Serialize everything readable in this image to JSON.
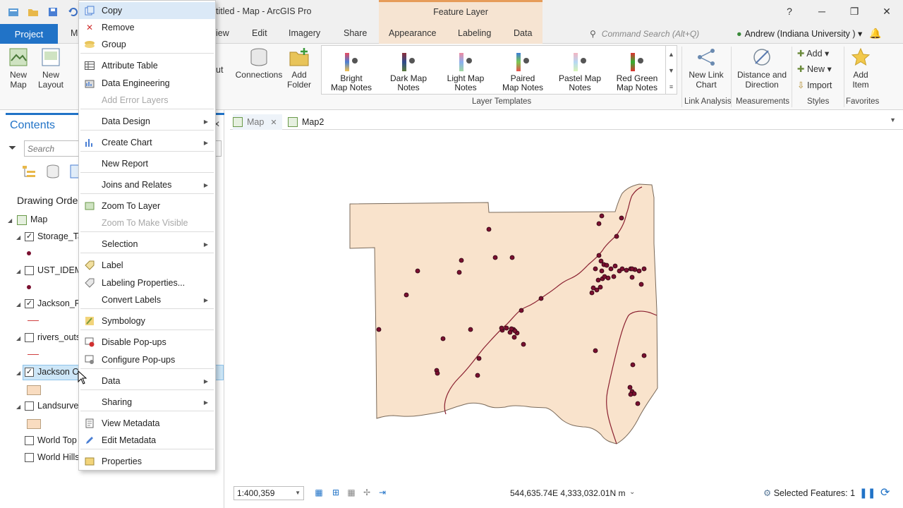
{
  "window": {
    "title": "titled - Map - ArcGIS Pro",
    "contextual_band": "Feature Layer",
    "help": "?",
    "minimize": "─",
    "restore": "❐",
    "close": "✕"
  },
  "tabs": {
    "project": "Project",
    "map_partial": "M",
    "view_partial": "iew",
    "edit": "Edit",
    "imagery": "Imagery",
    "share": "Share",
    "appearance": "Appearance",
    "labeling": "Labeling",
    "data": "Data"
  },
  "command_search": {
    "placeholder": "Command Search (Alt+Q)"
  },
  "user": {
    "name": "Andrew (Indiana University )"
  },
  "ribbon": {
    "new_map": "New\nMap",
    "new_layout": "New\nLayout",
    "out_partial": "ut",
    "connections": "Connections",
    "add_folder": "Add\nFolder",
    "gallery": [
      {
        "label": "Bright\nMap Notes",
        "colors": [
          "#e84a5f",
          "#4a7fd4",
          "#f2c14e"
        ]
      },
      {
        "label": "Dark Map\nNotes",
        "colors": [
          "#8b2f3a",
          "#2f4b8b",
          "#5a7a3a"
        ]
      },
      {
        "label": "Light Map\nNotes",
        "colors": [
          "#f08aa0",
          "#8ab0f0",
          "#a0d8a0"
        ]
      },
      {
        "label": "Paired\nMap Notes",
        "colors": [
          "#3b7dd8",
          "#7ec850",
          "#e85050"
        ]
      },
      {
        "label": "Pastel Map\nNotes",
        "colors": [
          "#f4b6c2",
          "#b6d8f4",
          "#d8f4b6"
        ]
      },
      {
        "label": "Red Green\nMap Notes",
        "colors": [
          "#e03030",
          "#30b030",
          "#e03030"
        ]
      }
    ],
    "layer_templates": "Layer Templates",
    "new_link_chart": "New Link\nChart",
    "link_analysis": "Link Analysis",
    "distance_direction": "Distance and\nDirection",
    "measurements": "Measurements",
    "styles_add": "Add",
    "styles_new": "New",
    "styles_import": "Import",
    "styles": "Styles",
    "add_item": "Add\nItem",
    "favorites": "Favorites"
  },
  "contents": {
    "title": "Contents",
    "search_placeholder": "Search",
    "drawing_order": "Drawing Orde",
    "map_label": "Map",
    "layers": [
      {
        "name": "Storage_Ta",
        "checked": true,
        "symbol": "point"
      },
      {
        "name": "UST_IDEM_",
        "checked": false,
        "symbol": "point"
      },
      {
        "name": "Jackson_Ri",
        "checked": true,
        "symbol": "line"
      },
      {
        "name": "rivers_outs",
        "checked": false,
        "symbol": "line"
      },
      {
        "name": "Jackson Co",
        "checked": true,
        "symbol": "polygon"
      },
      {
        "name": "Landsurvey",
        "checked": false,
        "symbol": "polygon"
      },
      {
        "name": "World Top",
        "checked": false,
        "symbol": "none"
      },
      {
        "name": "World Hills",
        "checked": false,
        "symbol": "none"
      }
    ]
  },
  "map_tabs": {
    "map": "Map",
    "map2": "Map2"
  },
  "status": {
    "scale": "1:400,359",
    "coordinates": "544,635.74E 4,333,032.01N m",
    "selected_features": "Selected Features: 1"
  },
  "context_menu": {
    "items": [
      {
        "label": "Copy",
        "icon": "copy-icon",
        "highlight": true
      },
      {
        "label": "Remove",
        "icon": "remove-icon"
      },
      {
        "label": "Group",
        "icon": "group-icon"
      },
      {
        "label": "Attribute Table",
        "icon": "table-icon"
      },
      {
        "label": "Data Engineering",
        "icon": "data-engineering-icon"
      },
      {
        "label": "Add Error Layers",
        "disabled": true
      },
      {
        "label": "Data Design",
        "submenu": true
      },
      {
        "label": "Create Chart",
        "icon": "chart-icon",
        "submenu": true
      },
      {
        "label": "New Report"
      },
      {
        "label": "Joins and Relates",
        "submenu": true
      },
      {
        "label": "Zoom To Layer",
        "icon": "zoom-layer-icon"
      },
      {
        "label": "Zoom To Make Visible",
        "disabled": true
      },
      {
        "label": "Selection",
        "submenu": true
      },
      {
        "label": "Label",
        "icon": "label-icon"
      },
      {
        "label": "Labeling Properties...",
        "icon": "labeling-properties-icon"
      },
      {
        "label": "Convert Labels",
        "submenu": true
      },
      {
        "label": "Symbology",
        "icon": "symbology-icon"
      },
      {
        "label": "Disable Pop-ups",
        "icon": "disable-popups-icon"
      },
      {
        "label": "Configure Pop-ups",
        "icon": "configure-popups-icon"
      },
      {
        "label": "Data",
        "submenu": true
      },
      {
        "label": "Sharing",
        "submenu": true
      },
      {
        "label": "View Metadata",
        "icon": "view-metadata-icon"
      },
      {
        "label": "Edit Metadata",
        "icon": "edit-metadata-icon"
      },
      {
        "label": "Properties",
        "icon": "properties-icon"
      }
    ]
  },
  "colors": {
    "accent": "#2173c7",
    "county_fill": "#f9e3cc",
    "county_stroke": "#7a6a5a",
    "point_fill": "#7a1030",
    "river": "#8a2030"
  }
}
